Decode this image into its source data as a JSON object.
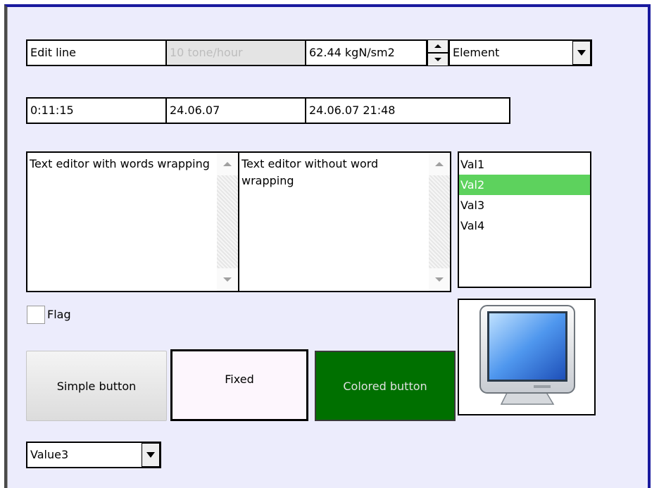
{
  "row1": {
    "edit_line": "Edit line",
    "disabled_field": "10 tone/hour",
    "spin_value": "62.44 kgN/sm2",
    "combo_value": "Element"
  },
  "row2": {
    "time": "0:11:15",
    "date": "24.06.07",
    "datetime": "24.06.07 21:48"
  },
  "memo_wrap": {
    "text": "Text editor with words wrapping"
  },
  "memo_nowrap": {
    "text": "Text editor without word\nwrapping"
  },
  "listbox": {
    "items": [
      "Val1",
      "Val2",
      "Val3",
      "Val4"
    ],
    "selected": "Val2"
  },
  "flag": {
    "label": "Flag",
    "checked": false
  },
  "buttons": {
    "simple": "Simple button",
    "fixed": "Fixed",
    "colored": "Colored button"
  },
  "image_button": {
    "icon": "monitor-icon"
  },
  "bottom_combo": {
    "value": "Value3"
  },
  "colors": {
    "panel_bg": "#ececfc",
    "selection": "#5dd25d",
    "colored_button": "#007000",
    "frame_border": "#1a1a9e"
  }
}
